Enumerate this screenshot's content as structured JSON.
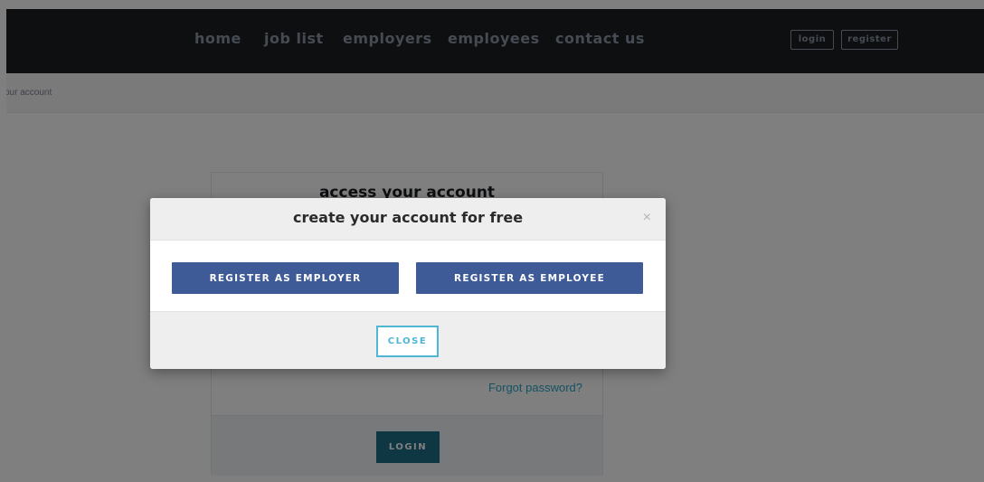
{
  "navbar": {
    "links": [
      "home",
      "job list",
      "employers",
      "employees",
      "contact us"
    ],
    "login_label": "login",
    "register_label": "register"
  },
  "breadcrumb": {
    "text": "your account"
  },
  "login_card": {
    "title": "access your account",
    "forgot_password": "Forgot password?",
    "login_button": "LOGIN"
  },
  "modal": {
    "title": "create your account for free",
    "close_symbol": "×",
    "register_employer": "REGISTER AS EMPLOYER",
    "register_employee": "REGISTER AS EMPLOYEE",
    "close_button": "CLOSE"
  },
  "colors": {
    "navbar_bg": "#1d1f22",
    "primary_button": "#3e5b98",
    "accent": "#4fb6d6",
    "overlay": "rgba(0,0,0,0.5)"
  }
}
